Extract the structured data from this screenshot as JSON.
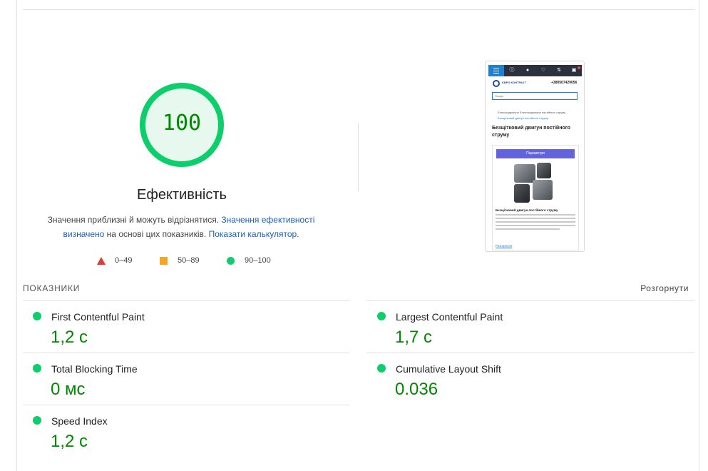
{
  "score": {
    "value": "100",
    "fraction": 1.0,
    "label": "Ефективність",
    "color": "#0cce6b"
  },
  "description": {
    "text1": "Значення приблизні й можуть відрізнятися. ",
    "link1": "Значення ефективності визначено",
    "text2": " на основі цих показників. ",
    "link2": "Показати калькулятор."
  },
  "legend": {
    "fail": "0–49",
    "average": "50–89",
    "pass": "90–100"
  },
  "screenshot": {
    "logo_text": "ЄВРО КОНТРАКТ",
    "phone": "+380507429056",
    "search_placeholder": "Пошук",
    "breadcrumb": "Електродвигуни     Електродвигуни постійного струму",
    "breadcrumb_current": "Безщітковий двигун постійного струму",
    "title": "Безщітковий двигун постійного струму",
    "params_button": "Параметри",
    "desc_heading": "Безщітковий двигун постійного струму",
    "more_link": "Розгорнути"
  },
  "metrics": {
    "section_title": "ПОКАЗНИКИ",
    "expand_label": "Розгорнути",
    "items": [
      {
        "name": "First Contentful Paint",
        "value": "1,2 с"
      },
      {
        "name": "Largest Contentful Paint",
        "value": "1,7 с"
      },
      {
        "name": "Total Blocking Time",
        "value": "0 мс"
      },
      {
        "name": "Cumulative Layout Shift",
        "value": "0.036"
      },
      {
        "name": "Speed Index",
        "value": "1,2 с"
      }
    ]
  }
}
